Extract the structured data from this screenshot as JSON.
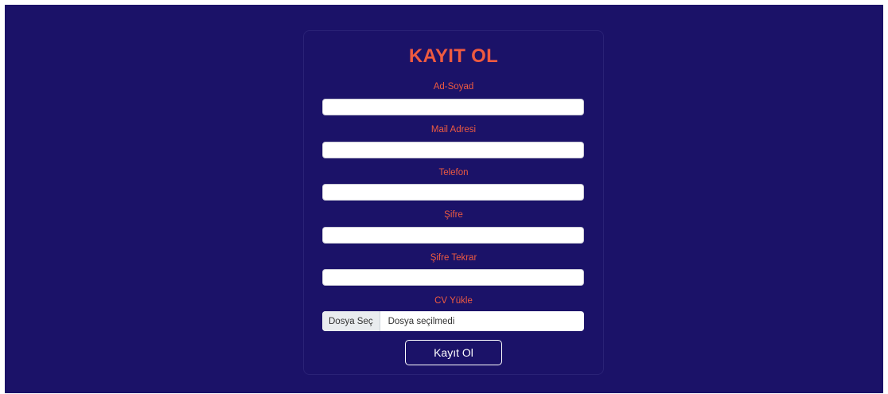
{
  "form": {
    "title": "KAYIT OL",
    "fields": [
      {
        "label": "Ad-Soyad",
        "value": ""
      },
      {
        "label": "Mail Adresi",
        "value": ""
      },
      {
        "label": "Telefon",
        "value": ""
      },
      {
        "label": "Şifre",
        "value": ""
      },
      {
        "label": "Şifre Tekrar",
        "value": ""
      }
    ],
    "cv": {
      "label": "CV Yükle",
      "button_label": "Dosya Seç",
      "status": "Dosya seçilmedi"
    },
    "submit_label": "Kayıt Ol"
  },
  "colors": {
    "background": "#1b1268",
    "accent": "#ee5a40",
    "input_background": "#ffffff"
  }
}
